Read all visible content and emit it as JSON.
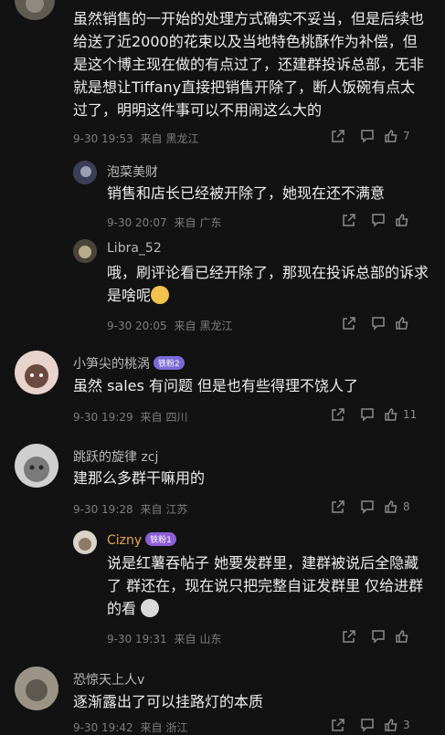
{
  "comments": [
    {
      "name": "",
      "text": "虽然销售的一开始的处理方式确实不妥当，但是后续也给送了近2000的花束以及当地特色桃酥作为补偿，但是这个博主现在做的有点过了，还建群投诉总部，无非就是想让Tiffany直接把销售开除了，断人饭碗有点太过了，明明这件事可以不用闹这么大的",
      "date": "9-30 19:53",
      "from": "来自",
      "location": "黑龙江",
      "likes": "7"
    },
    {
      "name": "泡菜美财",
      "text": "销售和店长已经被开除了，她现在还不满意",
      "date": "9-30 20:07",
      "from": "来自",
      "location": "广东",
      "likes": ""
    },
    {
      "name": "Libra_52",
      "text": "哦，刷评论看已经开除了，那现在投诉总部的诉求是啥呢",
      "date": "9-30 20:05",
      "from": "来自",
      "location": "黑龙江",
      "likes": ""
    },
    {
      "name": "小笋尖的桃涡",
      "badge": "铁粉2",
      "text": "虽然 sales 有问题 但是也有些得理不饶人了",
      "date": "9-30 19:29",
      "from": "来自",
      "location": "四川",
      "likes": "11"
    },
    {
      "name": "跳跃的旋律 zcj",
      "text": "建那么多群干嘛用的",
      "date": "9-30 19:28",
      "from": "来自",
      "location": "江苏",
      "likes": "8"
    },
    {
      "name": "Cizny",
      "badge": "铁粉1",
      "text": "说是红薯吞帖子  她要发群里，建群被说后全隐藏了  群还在，现在说只把完整自证发群里  仅给进群的看",
      "date": "9-30 19:31",
      "from": "来自",
      "location": "山东",
      "likes": ""
    },
    {
      "name": "恐惊天上人v",
      "text": "逐渐露出了可以挂路灯的本质",
      "date": "9-30 19:42",
      "from": "来自",
      "location": "浙江",
      "likes": "3"
    }
  ],
  "colors": {
    "background": "#121212",
    "text": "#ececec",
    "meta": "#7d7d7d",
    "name": "#b9b9b9",
    "cizny": "#e9a64f"
  }
}
